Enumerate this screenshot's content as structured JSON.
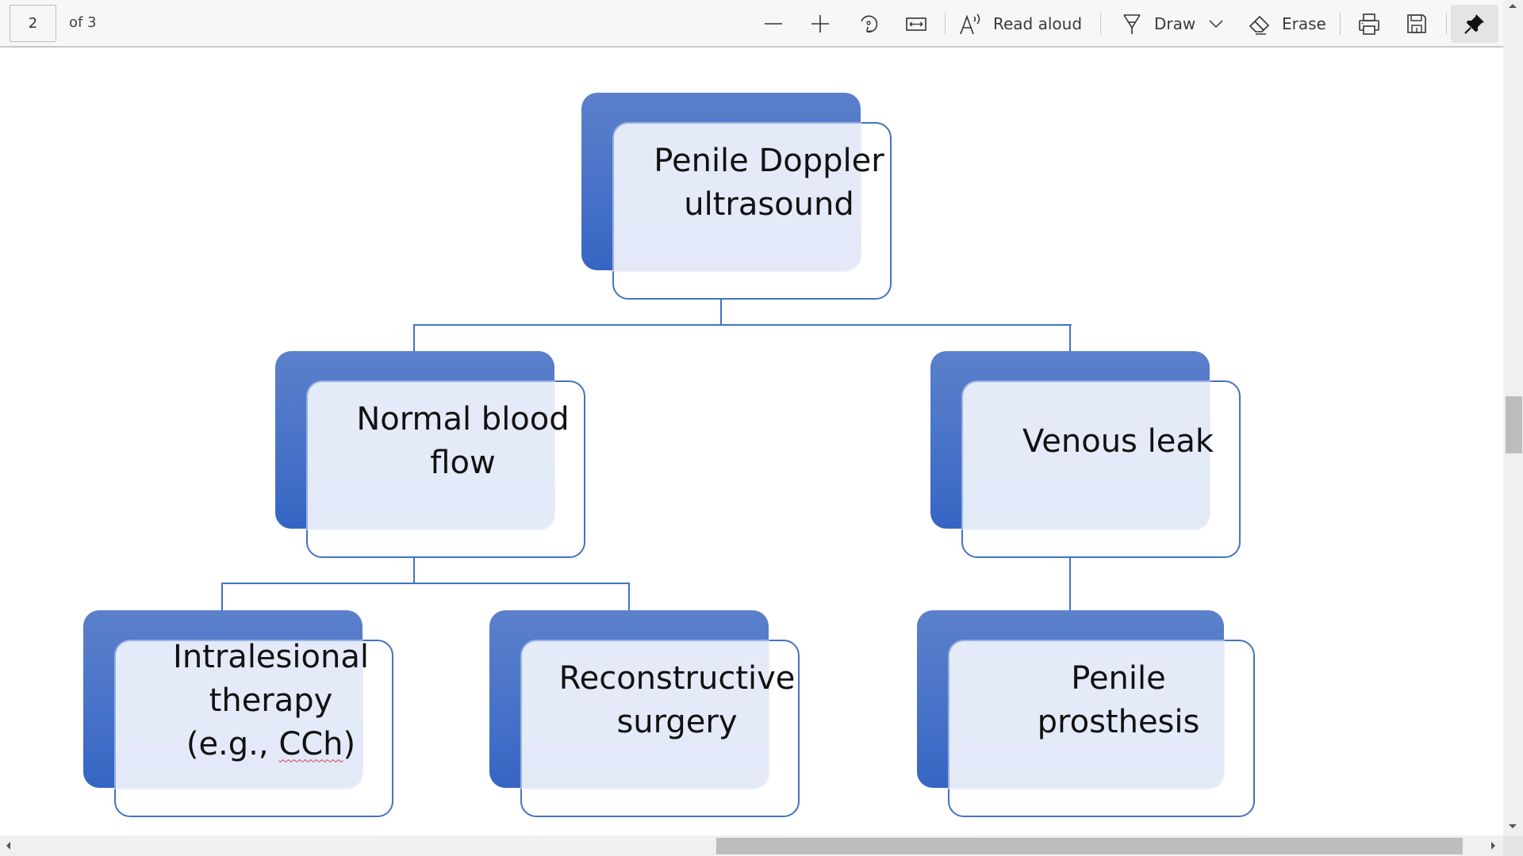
{
  "toolbar": {
    "page_current": "2",
    "page_total": "of 3",
    "zoom_out": "zoom-out",
    "zoom_in": "zoom-in",
    "rotate": "rotate",
    "fit_width": "fit-to-width",
    "read_aloud_label": "Read aloud",
    "draw_label": "Draw",
    "erase_label": "Erase",
    "print": "print",
    "save": "save",
    "pin": "pin-toolbar"
  },
  "diagram": {
    "accent_color": "#4472c4",
    "root": {
      "line1": "Penile Doppler",
      "line2": "ultrasound"
    },
    "level2": [
      {
        "line1": "Normal blood",
        "line2": "flow"
      },
      {
        "line1": "Venous leak"
      }
    ],
    "level3": [
      {
        "line1": "Intralesional",
        "line2": "therapy",
        "line3_prefix": "(e.g., ",
        "line3_marked": "CCh",
        "line3_suffix": ")"
      },
      {
        "line1": "Reconstructive",
        "line2": "surgery"
      },
      {
        "line1": "Penile",
        "line2": "prosthesis"
      }
    ]
  },
  "scroll": {
    "vertical_position_fraction": 0.48,
    "horizontal_position_fraction": 0.96
  }
}
